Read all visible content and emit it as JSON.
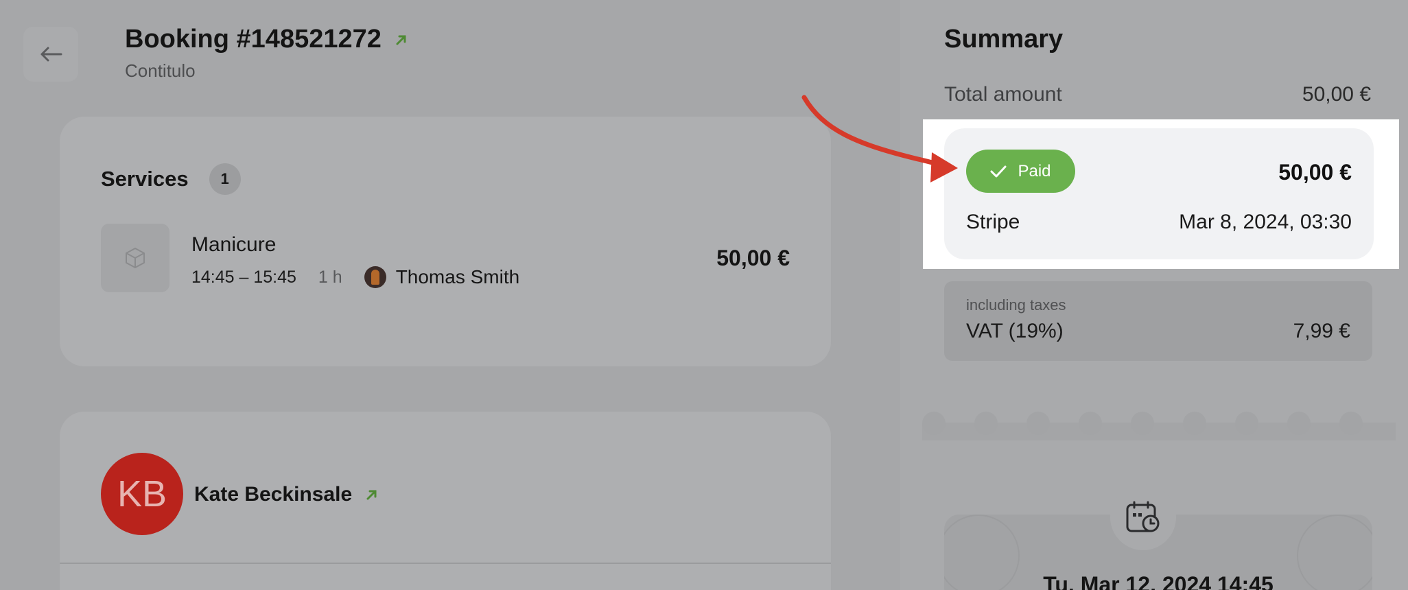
{
  "header": {
    "title": "Booking #148521272",
    "subtitle": "Contitulo"
  },
  "services": {
    "title": "Services",
    "count": "1",
    "items": [
      {
        "name": "Manicure",
        "time": "14:45 – 15:45",
        "duration": "1 h",
        "staff": "Thomas Smith",
        "price": "50,00 €"
      }
    ]
  },
  "client": {
    "initials": "KB",
    "name": "Kate Beckinsale",
    "avatar_color": "#b9231c"
  },
  "summary": {
    "title": "Summary",
    "total_label": "Total amount",
    "total_value": "50,00 €",
    "payment": {
      "status": "Paid",
      "amount": "50,00 €",
      "provider": "Stripe",
      "date": "Mar 8, 2024, 03:30",
      "status_color": "#6ab14d"
    },
    "tax": {
      "note": "including taxes",
      "label": "VAT (19%)",
      "value": "7,99 €"
    },
    "appointment_date": "Tu, Mar 12, 2024 14:45"
  },
  "icons": {
    "back": "arrow-left-icon",
    "external": "external-link-arrow-icon",
    "service": "box-icon",
    "check": "check-icon",
    "calendar": "calendar-clock-icon"
  },
  "colors": {
    "accent_green": "#6ab14d",
    "annotation_arrow": "#d63a2a"
  }
}
